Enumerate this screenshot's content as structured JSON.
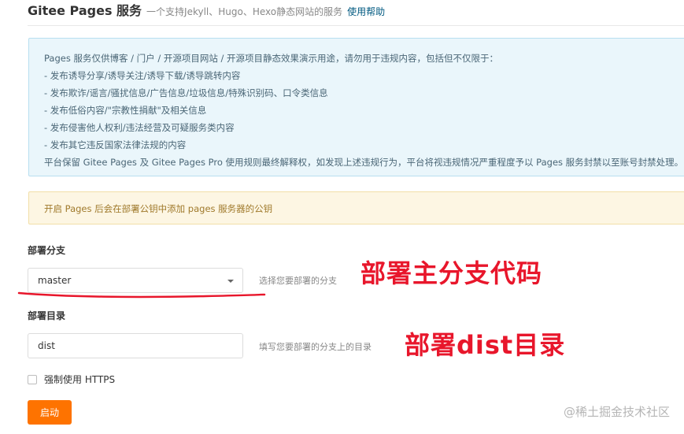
{
  "header": {
    "title": "Gitee Pages 服务",
    "subtitle": "一个支持Jekyll、Hugo、Hexo静态网站的服务",
    "help_link": "使用帮助"
  },
  "notice": {
    "lines": [
      "Pages 服务仅供博客 / 门户 / 开源项目网站 / 开源项目静态效果演示用途，请勿用于违规内容，包括但不仅限于：",
      "- 发布诱导分享/诱导关注/诱导下载/诱导跳转内容",
      "- 发布欺诈/谣言/骚扰信息/广告信息/垃圾信息/特殊识别码、口令类信息",
      "- 发布低俗内容/\"宗教性捐献\"及相关信息",
      "- 发布侵害他人权利/违法经营及可疑服务类内容",
      "- 发布其它违反国家法律法规的内容",
      "平台保留 Gitee Pages 及 Gitee Pages Pro 使用规则最终解释权，如发现上述违规行为，平台将视违规情况严重程度予以 Pages 服务封禁以至账号封禁处理。"
    ]
  },
  "warning": {
    "text": "开启 Pages 后会在部署公钥中添加 pages 服务器的公钥"
  },
  "branch": {
    "label": "部署分支",
    "selected": "master",
    "hint": "选择您要部署的分支"
  },
  "directory": {
    "label": "部署目录",
    "value": "dist",
    "hint": "填写您要部署的分支上的目录"
  },
  "https": {
    "label": "强制使用 HTTPS",
    "checked": false
  },
  "start_button": "启动",
  "annotations": {
    "branch_note": "部署主分支代码",
    "dir_note": "部署dist目录"
  },
  "watermark": "@稀土掘金技术社区",
  "colors": {
    "accent": "#fe7300",
    "annotation": "#e8162b",
    "link": "#005980"
  }
}
